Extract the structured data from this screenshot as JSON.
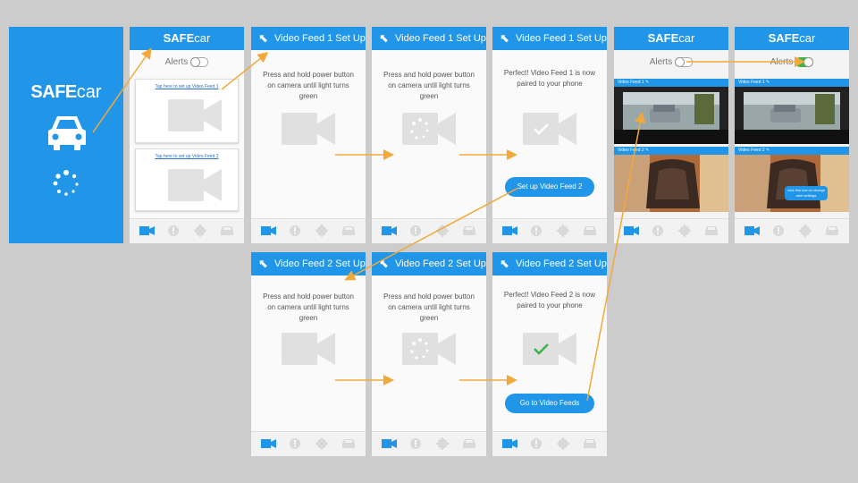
{
  "brand": {
    "bold": "SAFE",
    "light": "car"
  },
  "splash": {},
  "home": {
    "alerts_label": "Alerts",
    "card1_link": "Tap here to set up Video Feed 1",
    "card2_link": "Tap here to set up Video Feed 2"
  },
  "feed1_steps": {
    "title": "Video Feed 1 Set Up",
    "press_text": "Press and hold power button on camera until light turns green",
    "done_text": "Perfect! Video Feed 1 is now paired to your phone",
    "button": "Set up Video Feed 2"
  },
  "feed2_steps": {
    "title": "Video Feed 2 Set Up",
    "press_text": "Press and hold power button on camera until light turns green",
    "done_text": "Perfect! Video Feed 2 is now paired to your phone",
    "button": "Go to Video Feeds"
  },
  "feeds": {
    "alerts_label": "Alerts",
    "feed1_label": "Video Feed 1",
    "feed2_label": "Video Feed 2",
    "tip": "click this icon to change alert settings"
  },
  "colors": {
    "primary": "#2196e8",
    "arrow": "#f2a93b",
    "toggle_on": "#3bb54a"
  },
  "icons": [
    "video-camera-icon",
    "alert-icon",
    "gear-icon",
    "car-icon",
    "back-arrow-icon",
    "loading-spinner-icon",
    "check-icon",
    "pencil-icon"
  ]
}
